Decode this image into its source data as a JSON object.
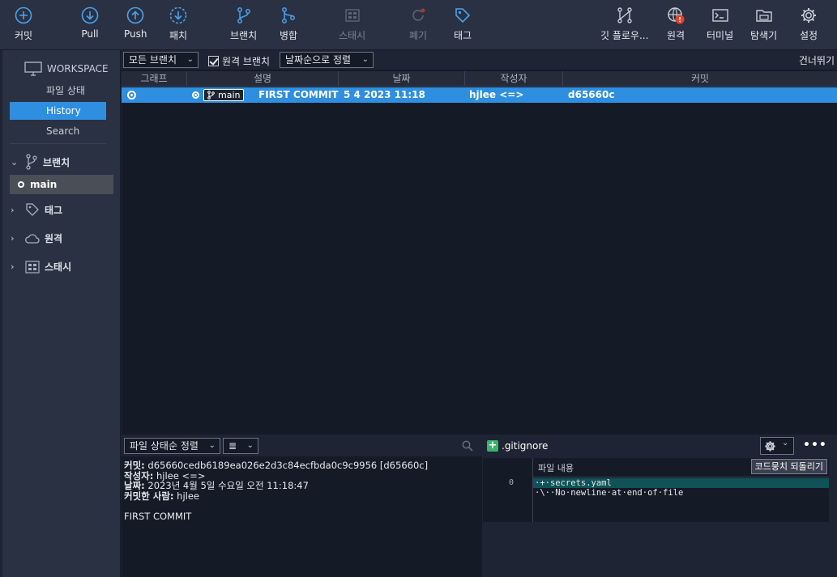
{
  "toolbar": {
    "commit": "커밋",
    "pull": "Pull",
    "push": "Push",
    "fetch": "패치",
    "branch": "브랜치",
    "merge": "병합",
    "stash": "스태시",
    "discard": "폐기",
    "tag": "태그",
    "git_flow": "깃 플로우...",
    "remote": "원격",
    "terminal": "터미널",
    "explorer": "탐색기",
    "settings": "설정"
  },
  "sidebar": {
    "workspace_title": "WORKSPACE",
    "items": [
      {
        "label": "파일 상태"
      },
      {
        "label": "History"
      },
      {
        "label": "Search"
      }
    ],
    "branches_label": "브랜치",
    "current_branch": "main",
    "tags_label": "태그",
    "remotes_label": "원격",
    "stashes_label": "스태시"
  },
  "filters": {
    "branch_filter": "모든 브랜치",
    "remote_branch_label": "원격 브랜치",
    "sort_order": "날짜순으로 정렬",
    "skip_label": "건너뛰기"
  },
  "columns": {
    "graph": "그래프",
    "description": "설명",
    "date": "날짜",
    "author": "작성자",
    "commit": "커밋"
  },
  "commits": [
    {
      "branch_tag": "main",
      "message": "FIRST COMMIT",
      "date": "5 4 2023 11:18",
      "author": "hjlee <=>",
      "hash": "d65660c"
    }
  ],
  "bottom_left": {
    "sort_select": "파일 상태순 정렬",
    "view_select": "≣",
    "commit_label": "커밋:",
    "commit_value": "d65660cedb6189ea026e2d3c84ecfbda0c9c9956 [d65660c]",
    "author_label": "작성자:",
    "author_value": "hjlee <=>",
    "date_label": "날짜:",
    "date_value": "2023년 4월 5일 수요일 오전 11:18:47",
    "committer_label": "커밋한 사람:",
    "committer_value": "hjlee",
    "message": "FIRST COMMIT"
  },
  "bottom_right": {
    "file_name": ".gitignore",
    "content_label": "파일 내용",
    "revert_button": "코드뭉치 되돌리기",
    "line_number": "0",
    "lines": [
      "·+·secrets.yaml",
      "·\\··No·newline·at·end·of·file"
    ]
  },
  "colors": {
    "accent": "#2e8fe0",
    "added": "#3bb36b",
    "alert": "#e5432b"
  }
}
